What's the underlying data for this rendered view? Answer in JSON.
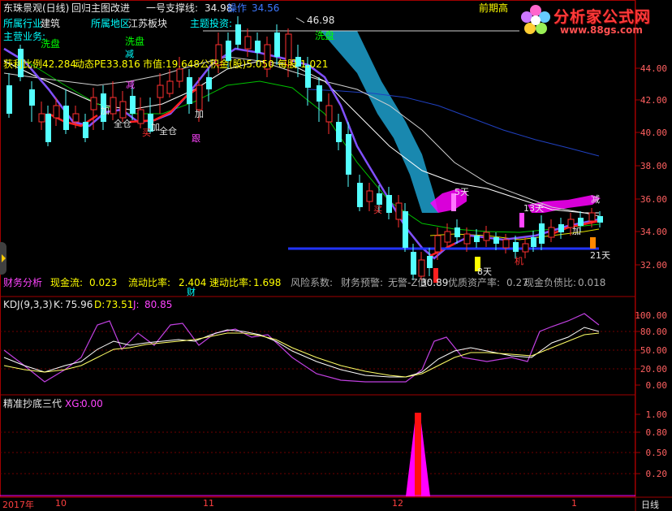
{
  "header": {
    "stock_name": "东珠景观(日线)",
    "template": "回归主图改进",
    "support_label": "一号支撑线:",
    "support_value": "34.98",
    "operate_label": "操作",
    "operate_value": "34.56",
    "prev_high_label": "前期高"
  },
  "info_rows": {
    "industry_label": "所属行业",
    "industry_value": "建筑",
    "region_label": "所属地区",
    "region_value": "江苏板块",
    "theme_label": "主题投资:",
    "theme_value": "洗盘",
    "business_label": "主营业务:",
    "wash_1": "洗盘",
    "wash_2": "洗盘",
    "wash_3": "洗盘",
    "peak_value": "46.98"
  },
  "fundamentals": {
    "profit_ratio": "获利比例42.284",
    "pe": "动态PE33.816",
    "market_value": "市值:19.648",
    "reserve": "公积金(股)5.050",
    "eps_label": "每股",
    "eps_value": "1.021"
  },
  "financials": {
    "analysis_label": "财务分析",
    "cash_label": "现金流:",
    "cash_value": "0.023",
    "liquid_label": "流动比率:",
    "liquid_value": "2.404",
    "quick_label": "速动比率:",
    "quick_value": "1.698",
    "risk_label": "风险系数:",
    "warn_label": "财务预警:",
    "warn_value": "无警-Z值:",
    "z_value": "30.89",
    "quality_label": "优质资产率:",
    "quality_value": "0.27",
    "debt_label": "现金负债比:",
    "debt_value": "0.018",
    "cai_mark": "财"
  },
  "signals": {
    "jian": "减",
    "jia": "加",
    "quancang": "全仓",
    "gen": "跟",
    "mai": "买",
    "tian5": "5天",
    "tian13": "13天",
    "tian21": "21天",
    "tian8": "8天",
    "ji": "机"
  },
  "main_axis": [
    "44.00",
    "42.00",
    "40.00",
    "38.00",
    "36.00",
    "34.00",
    "32.00"
  ],
  "kdj": {
    "title": "KDJ(9,3,3)",
    "k_label": "K:",
    "k_value": "75.96",
    "d_label": "D:",
    "d_value": "73.51",
    "j_label": "J:",
    "j_value": "80.85",
    "axis": [
      "100.00",
      "80.00",
      "50.00",
      "20.00",
      "0.00"
    ]
  },
  "xg": {
    "title": "精准抄底三代",
    "label": "XG:",
    "value": "0.00",
    "axis": [
      "1.00",
      "0.80",
      "0.50",
      "0.20"
    ]
  },
  "xaxis": {
    "year": "2017年",
    "m10": "10",
    "m11": "11",
    "m12": "12",
    "m1": "1",
    "period": "日线"
  },
  "logo": {
    "text": "分析家公式网",
    "url": "www.88gs.com"
  },
  "colors": {
    "up": "#ff3030",
    "down": "#54ffff",
    "kline_k": "#ffffff",
    "kline_d": "#ffff66",
    "kline_j": "#ff44ff",
    "support": "#2222ff"
  }
}
